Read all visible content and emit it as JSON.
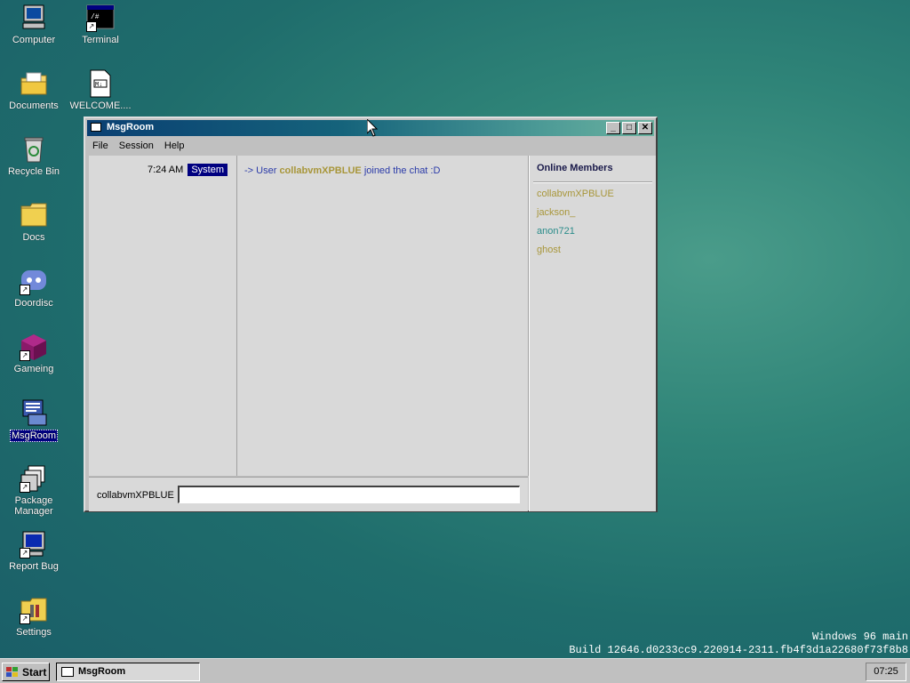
{
  "desktop": {
    "icons": [
      {
        "label": "Computer",
        "icon": "computer-icon"
      },
      {
        "label": "Terminal",
        "icon": "terminal-icon"
      },
      {
        "label": "Documents",
        "icon": "documents-folder-icon"
      },
      {
        "label": "WELCOME....",
        "icon": "markdown-file-icon"
      },
      {
        "label": "Recycle Bin",
        "icon": "recycle-bin-icon"
      },
      {
        "label": "Docs",
        "icon": "folder-icon"
      },
      {
        "label": "Doordisc",
        "icon": "doordisc-icon"
      },
      {
        "label": "Gameing",
        "icon": "cube-icon"
      },
      {
        "label": "MsgRoom",
        "icon": "msgroom-icon"
      },
      {
        "label": "Package Manager",
        "icon": "package-manager-icon"
      },
      {
        "label": "Report Bug",
        "icon": "report-bug-icon"
      },
      {
        "label": "Settings",
        "icon": "settings-icon"
      }
    ],
    "build_line1": "Windows 96 main",
    "build_line2": "Build 12646.d0233cc9.220914-2311.fb4f3d1a22680f73f8b8"
  },
  "window": {
    "title": "MsgRoom",
    "buttons": {
      "minimize": "_",
      "maximize": "□",
      "close": "✕"
    },
    "menu": [
      "File",
      "Session",
      "Help"
    ],
    "messages": [
      {
        "time": "7:24 AM",
        "sender": "System",
        "prefix": "-> User",
        "user": "collabvmXPBLUE",
        "suffix": "joined the chat :D"
      }
    ],
    "members_title": "Online Members",
    "members": [
      {
        "name": "collabvmXPBLUE",
        "color": "#a8963a"
      },
      {
        "name": "jackson_",
        "color": "#a8963a"
      },
      {
        "name": "anon721",
        "color": "#2a8c8a"
      },
      {
        "name": "ghost",
        "color": "#a8963a"
      }
    ],
    "nick": "collabvmXPBLUE",
    "input_value": ""
  },
  "taskbar": {
    "start_label": "Start",
    "task_label": "MsgRoom",
    "clock": "07:25"
  }
}
